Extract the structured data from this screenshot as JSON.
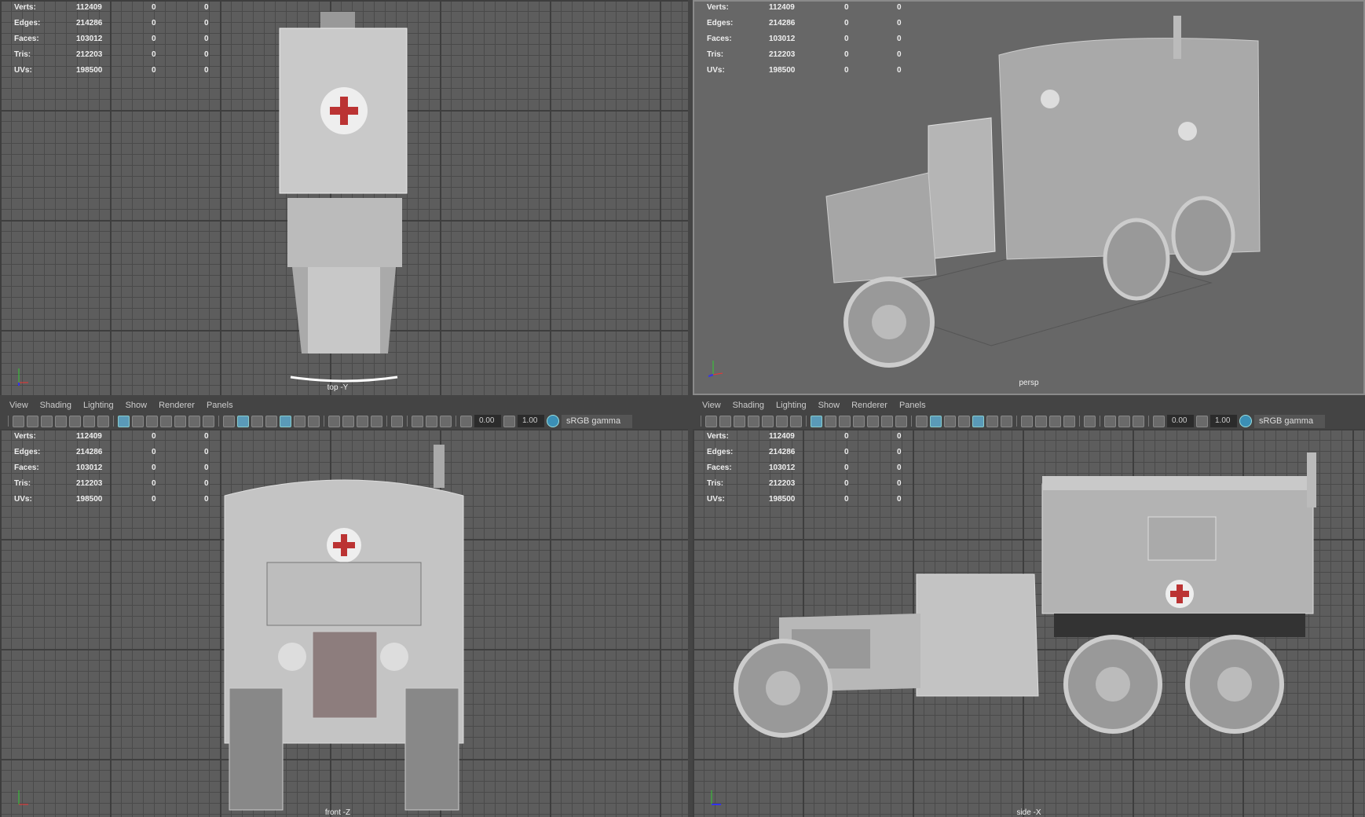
{
  "stats": [
    {
      "label": "Verts:",
      "value": "112409",
      "c1": "0",
      "c2": "0"
    },
    {
      "label": "Edges:",
      "value": "214286",
      "c1": "0",
      "c2": "0"
    },
    {
      "label": "Faces:",
      "value": "103012",
      "c1": "0",
      "c2": "0"
    },
    {
      "label": "Tris:",
      "value": "212203",
      "c1": "0",
      "c2": "0"
    },
    {
      "label": "UVs:",
      "value": "198500",
      "c1": "0",
      "c2": "0"
    }
  ],
  "viewports": {
    "top": "top -Y",
    "persp": "persp",
    "front": "front -Z",
    "side": "side -X"
  },
  "menu": [
    "View",
    "Shading",
    "Lighting",
    "Show",
    "Renderer",
    "Panels"
  ],
  "toolbar": {
    "icons_a": [
      "camera-icon",
      "camera-attr-icon",
      "bookmark-icon",
      "image-plane-icon",
      "grid-toggle-icon",
      "pivot-icon",
      "paint-icon"
    ],
    "icons_b": [
      "grid-icon",
      "film-gate-icon",
      "resolution-gate-icon",
      "gate-mask-icon",
      "field-chart-icon",
      "safe-action-icon",
      "safe-title-icon"
    ],
    "icons_c": [
      "wireframe-icon",
      "smooth-shade-icon",
      "default-material-icon",
      "wireframe-on-shaded-icon",
      "xray-icon",
      "use-lights-icon",
      "shadows-icon"
    ],
    "icons_d": [
      "ambient-occlusion-icon",
      "motion-blur-icon",
      "anti-alias-icon",
      "depth-of-field-icon"
    ],
    "icons_e": [
      "isolate-select-icon"
    ],
    "icons_f": [
      "xray-joints-icon",
      "xray-active-icon",
      "backface-icon"
    ],
    "exposure": "0.00",
    "gamma": "1.00",
    "color_space": "sRGB gamma"
  },
  "colors": {
    "accent": "#5a9ab8",
    "viewport_bg": "#5d5d5d",
    "persp_bg": "#676767"
  }
}
